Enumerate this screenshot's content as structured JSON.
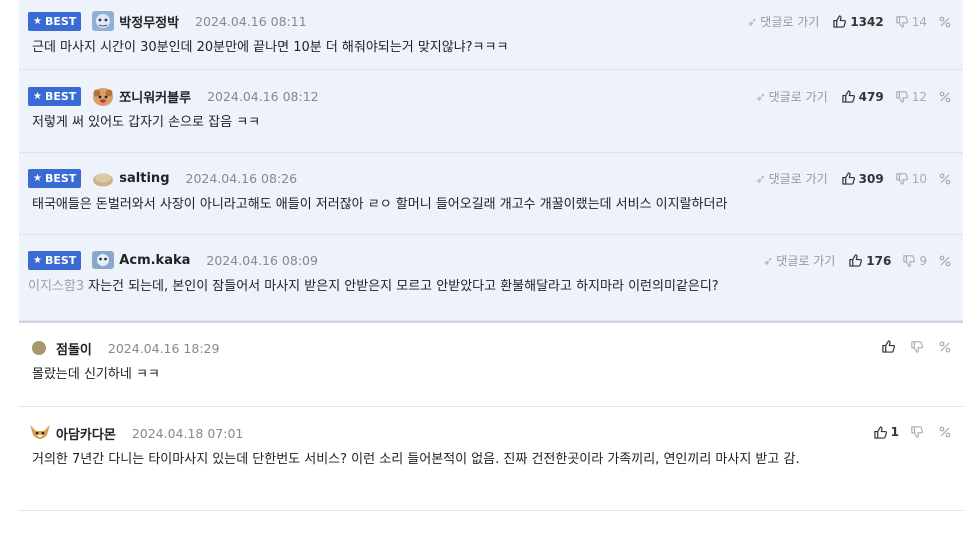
{
  "best_label": "BEST",
  "goto_label": "댓글로 가기",
  "comments": [
    {
      "best": true,
      "nick": "박정무정박",
      "time": "2024.04.16 08:11",
      "like": "1342",
      "dislike": "14",
      "mention": "",
      "text": "근데 마사지 시간이 30분인데 20분만에 끝나면 10분 더 해줘야되는거 맞지않냐?ㅋㅋㅋ"
    },
    {
      "best": true,
      "nick": "쪼니워커블루",
      "time": "2024.04.16 08:12",
      "like": "479",
      "dislike": "12",
      "mention": "",
      "text": "저렇게 써 있어도 갑자기 손으로 잡음 ㅋㅋ"
    },
    {
      "best": true,
      "nick": "salting",
      "time": "2024.04.16 08:26",
      "like": "309",
      "dislike": "10",
      "mention": "",
      "text": "태국애들은 돈벌러와서 사장이 아니라고해도 애들이 저러잖아 ㄹㅇ 할머니 들어오길래 개고수 개꿀이랬는데 서비스 이지랄하더라"
    },
    {
      "best": true,
      "nick": "Acm.kaka",
      "time": "2024.04.16 08:09",
      "like": "176",
      "dislike": "9",
      "mention": "이지스함3",
      "text": "자는건 되는데, 본인이 잠들어서 마사지 받은지 안받은지 모르고 안받았다고 환불해달라고 하지마라 이런의미같은디?"
    },
    {
      "best": false,
      "nick": "점돌이",
      "time": "2024.04.16 18:29",
      "like": "",
      "dislike": "",
      "mention": "",
      "text": "몰랐는데 신기하네 ㅋㅋ"
    },
    {
      "best": false,
      "nick": "아담카다몬",
      "time": "2024.04.18 07:01",
      "like": "1",
      "dislike": "",
      "mention": "",
      "text": "거의한 7년간 다니는 타이마사지 있는데 단한번도 서비스? 이런 소리 들어본적이 없음. 진짜 건전한곳이라 가족끼리, 연인끼리 마사지 받고 감."
    }
  ]
}
